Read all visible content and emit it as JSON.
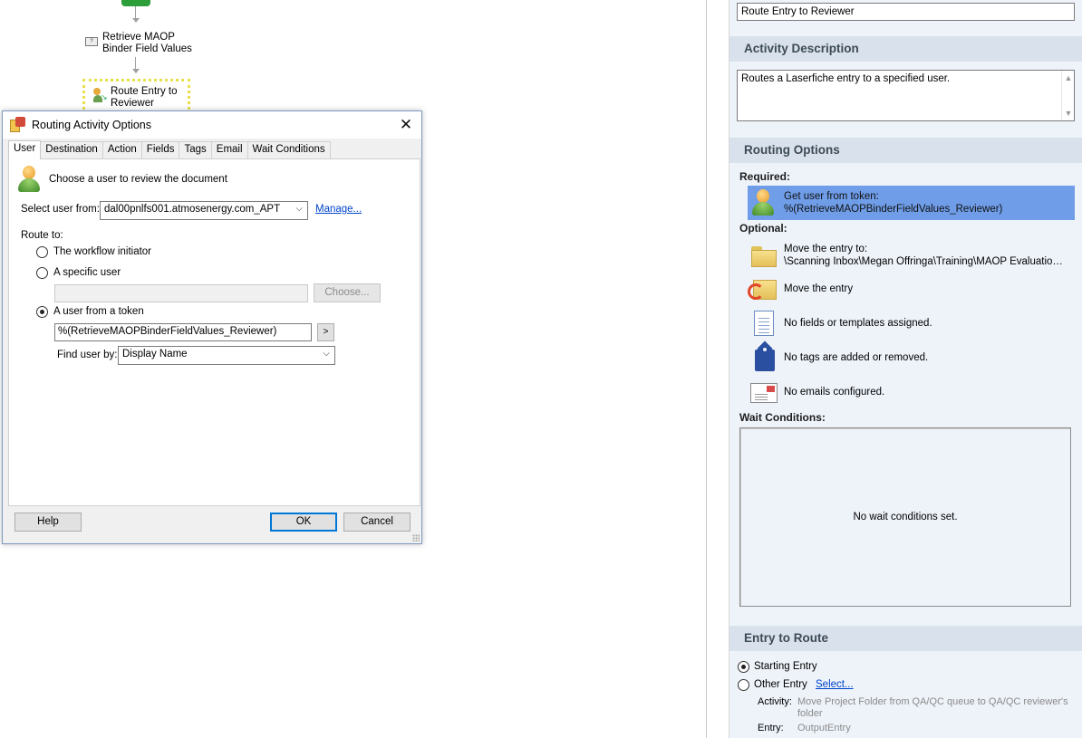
{
  "workflow": {
    "nodes": [
      {
        "label": "Retrieve MAOP\nBinder Field Values"
      },
      {
        "label": "Route Entry to\nReviewer"
      }
    ]
  },
  "properties": {
    "name_value": "Route Entry to Reviewer",
    "activity_description": {
      "header": "Activity Description",
      "text": "Routes a Laserfiche entry to a specified user."
    },
    "routing_options": {
      "header": "Routing Options",
      "required_label": "Required:",
      "required_item": {
        "line1": "Get user from token:",
        "line2": "%(RetrieveMAOPBinderFieldValues_Reviewer)",
        "icon": "user-icon"
      },
      "optional_label": "Optional:",
      "optional_items": [
        {
          "line1": "Move the entry to:",
          "line2": "\\Scanning Inbox\\Megan Offringa\\Training\\MAOP Evaluations\\...",
          "icon": "folder-icon"
        },
        {
          "line1": "Move the entry",
          "line2": "",
          "icon": "move-entry-icon"
        },
        {
          "line1": "No fields or templates assigned.",
          "line2": "",
          "icon": "document-icon"
        },
        {
          "line1": "No tags are added or removed.",
          "line2": "",
          "icon": "tag-icon"
        },
        {
          "line1": "No emails configured.",
          "line2": "",
          "icon": "email-icon"
        }
      ],
      "wait_label": "Wait Conditions:",
      "wait_empty": "No wait conditions set."
    },
    "entry_to_route": {
      "header": "Entry to Route",
      "starting_entry": "Starting Entry",
      "other_entry": "Other Entry",
      "select_link": "Select...",
      "activity_label": "Activity:",
      "activity_value": "Move Project Folder from QA/QC queue to QA/QC reviewer's folder",
      "entry_label": "Entry:",
      "entry_value": "OutputEntry"
    }
  },
  "dialog": {
    "title": "Routing Activity Options",
    "close_glyph": "✕",
    "tabs": [
      "User",
      "Destination",
      "Action",
      "Fields",
      "Tags",
      "Email",
      "Wait Conditions"
    ],
    "active_tab": "User",
    "heading": "Choose a user to review the document",
    "select_user_label": "Select user from:",
    "select_user_value": "dal00pnlfs001.atmosenergy.com_APT",
    "manage_link": "Manage...",
    "route_to_label": "Route to:",
    "options": {
      "initiator": "The workflow initiator",
      "specific": "A specific user",
      "token": "A user from a token"
    },
    "selected_option": "token",
    "specific_user_value": "",
    "choose_button": "Choose...",
    "token_value": "%(RetrieveMAOPBinderFieldValues_Reviewer)",
    "token_button": ">",
    "find_user_label": "Find user by:",
    "find_user_value": "Display Name",
    "help_button": "Help",
    "ok_button": "OK",
    "cancel_button": "Cancel"
  }
}
